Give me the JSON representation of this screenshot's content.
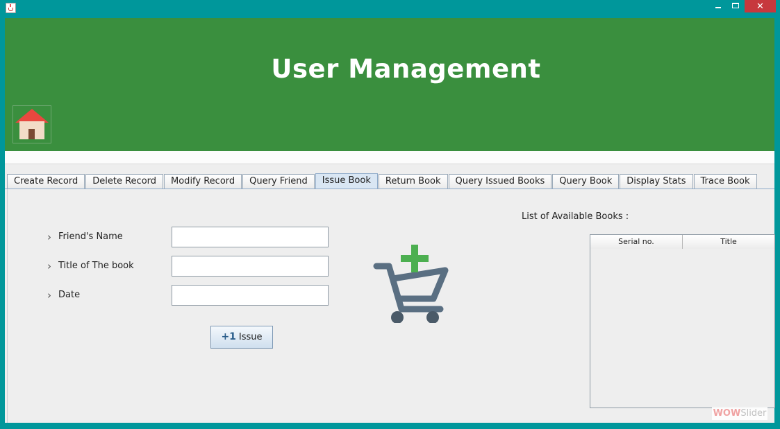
{
  "window": {
    "min_glyph": "",
    "max_glyph": "",
    "close_glyph": "✕"
  },
  "header": {
    "title": "User Management"
  },
  "tabs": [
    {
      "label": "Create Record"
    },
    {
      "label": "Delete Record"
    },
    {
      "label": "Modify Record"
    },
    {
      "label": "Query Friend"
    },
    {
      "label": "Issue Book",
      "active": true
    },
    {
      "label": "Return Book"
    },
    {
      "label": "Query Issued Books"
    },
    {
      "label": "Query Book"
    },
    {
      "label": "Display Stats"
    },
    {
      "label": "Trace Book"
    }
  ],
  "form": {
    "friend_name_label": "Friend's Name",
    "friend_name_value": "",
    "book_title_label": "Title of The book",
    "book_title_value": "",
    "date_label": "Date",
    "date_value": "",
    "issue_button_prefix": "+1",
    "issue_button_label": "Issue",
    "chevron": "›"
  },
  "books_list": {
    "heading": "List of Available Books :",
    "columns": [
      "Serial no.",
      "Title"
    ],
    "rows": []
  },
  "watermark": {
    "part1": "WOW",
    "part2": "Slider"
  },
  "colors": {
    "header_green": "#3a8f3e",
    "window_frame": "#00979b",
    "close_red": "#c7383d",
    "cart_gray": "#5a6f82",
    "cart_plus": "#4caf50"
  }
}
